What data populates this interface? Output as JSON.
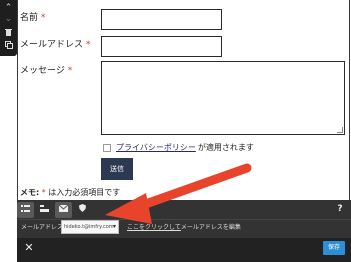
{
  "left_toolbar": {
    "up_icon": "⌃",
    "down_icon": "⌄",
    "trash_icon": "🗑",
    "copy_icon": "⧉"
  },
  "form": {
    "name_label": "名前",
    "email_label": "メールアドレス",
    "message_label": "メッセージ",
    "required_mark": "*",
    "privacy_link": "プライバシーポリシー",
    "privacy_suffix": "が適用されます",
    "submit_label": "送信",
    "memo_bold": "メモ:",
    "memo_required_mark": "*",
    "memo_text": "は入力必須項目です"
  },
  "panel": {
    "tools": [
      "☰",
      "▬",
      "✉",
      "⛉"
    ],
    "help_label": "?",
    "email_field_label": "メールアドレス:",
    "email_value": "hideko.t@imfry.com",
    "edit_link": "ここをクリックして",
    "edit_suffix": "メールアドレスを編集",
    "close_label": "✕",
    "save_label": "保存"
  },
  "colors": {
    "annotation_arrow": "#e8442c",
    "save_button": "#2f8fd6",
    "submit_button": "#2b3a52"
  }
}
